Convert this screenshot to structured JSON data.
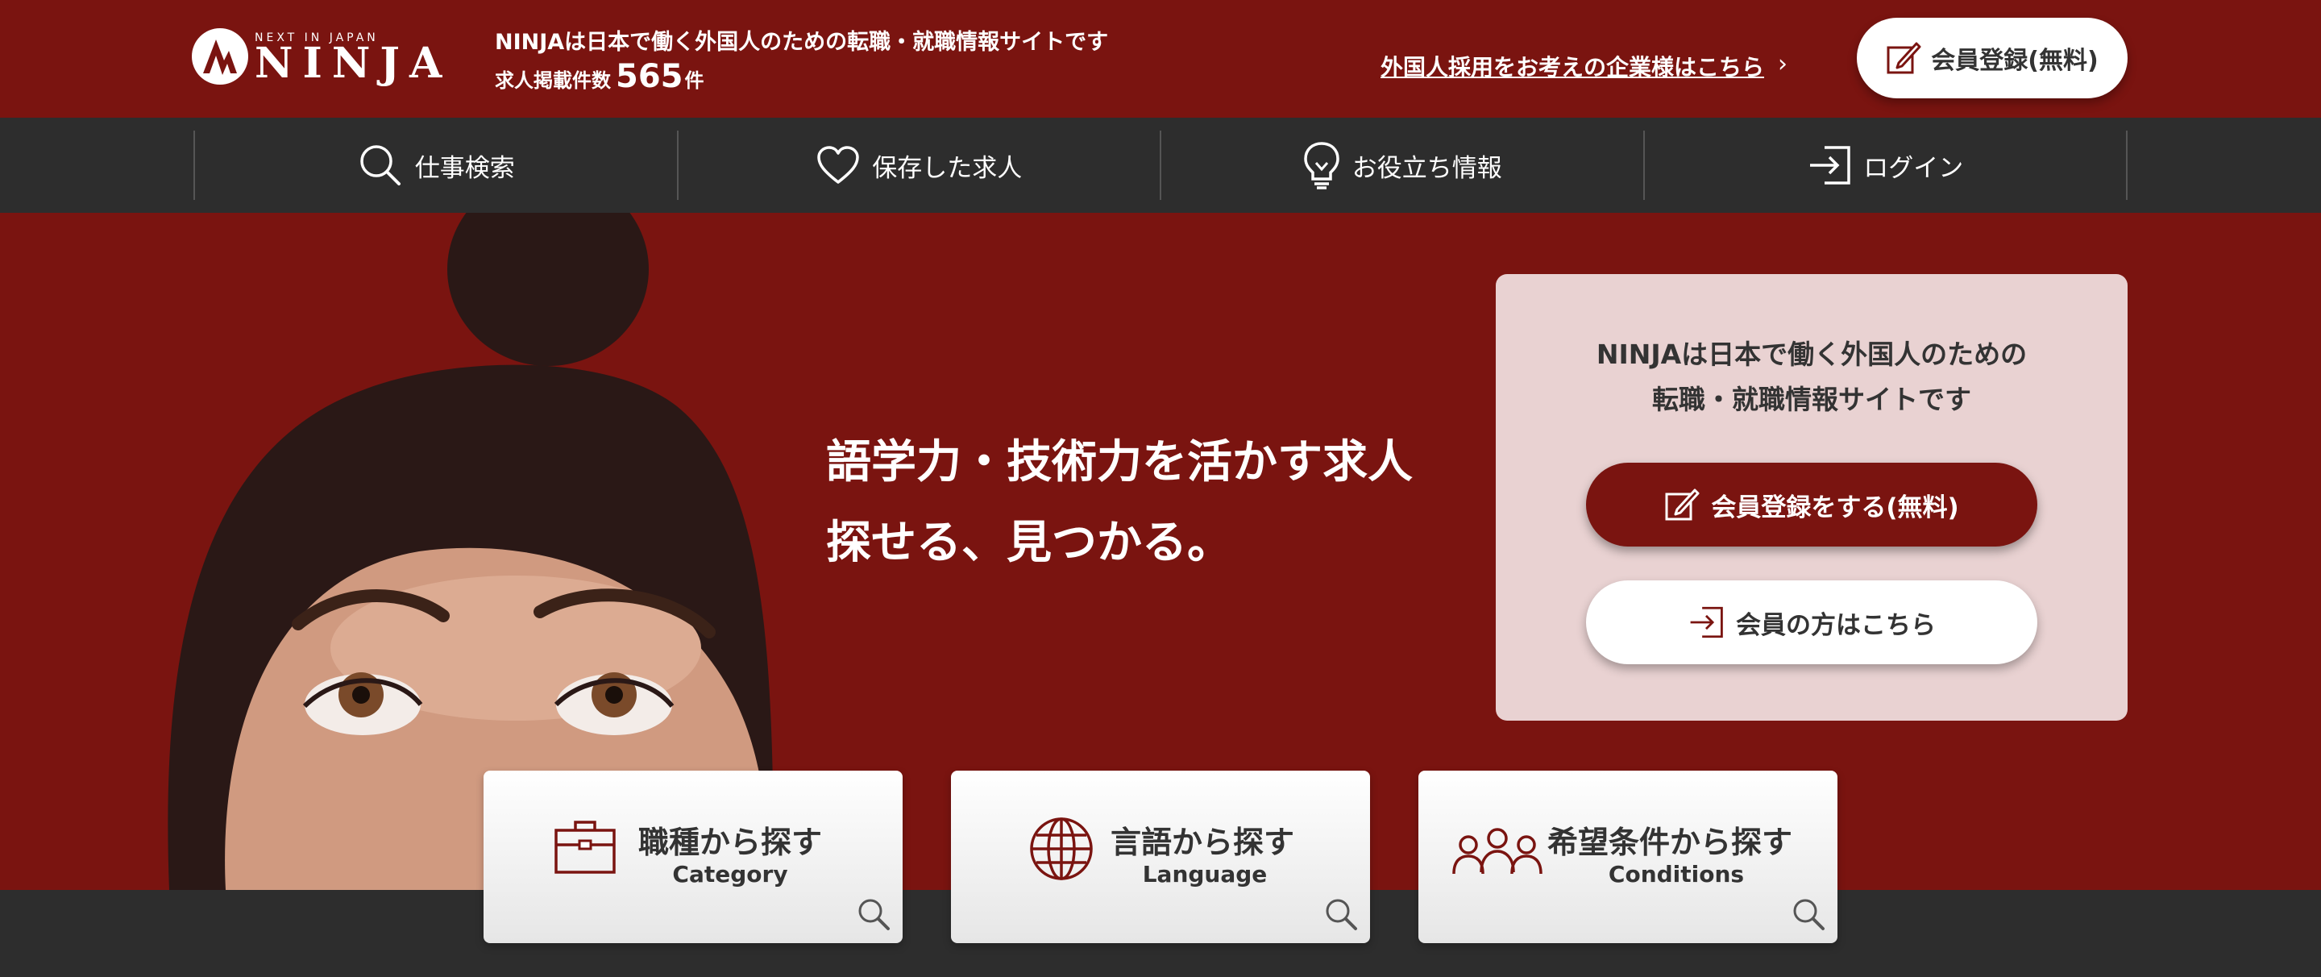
{
  "header": {
    "logo_tag": "NEXT IN JAPAN",
    "logo_text": "NINJA",
    "tagline": "NINJAは日本で働く外国人のための転職・就職情報サイトです",
    "count_label": "求人掲載件数",
    "count_value": "565",
    "count_unit": "件",
    "employer_link": "外国人採用をお考えの企業様はこちら",
    "register_label": "会員登録(無料)"
  },
  "nav": {
    "items": [
      {
        "label": "仕事検索",
        "icon": "search-icon"
      },
      {
        "label": "保存した求人",
        "icon": "heart-icon"
      },
      {
        "label": "お役立ち情報",
        "icon": "lightbulb-icon"
      },
      {
        "label": "ログイン",
        "icon": "login-icon"
      }
    ]
  },
  "hero": {
    "headline_line1": "語学力・技術力を活かす求人",
    "headline_line2": "探せる、見つかる。",
    "card": {
      "text_line1": "NINJAは日本で働く外国人のための",
      "text_line2": "転職・就職情報サイトです",
      "primary_button": "会員登録をする(無料)",
      "secondary_button": "会員の方はこちら"
    }
  },
  "search_tiles": [
    {
      "title": "職種から探す",
      "subtitle": "Category",
      "icon": "briefcase-icon"
    },
    {
      "title": "言語から探す",
      "subtitle": "Language",
      "icon": "globe-icon"
    },
    {
      "title": "希望条件から探す",
      "subtitle": "Conditions",
      "icon": "people-icon"
    }
  ],
  "colors": {
    "brand_red": "#7a1410",
    "dark_bar": "#2d2d2d",
    "card_pink": "#e9d2d2"
  }
}
